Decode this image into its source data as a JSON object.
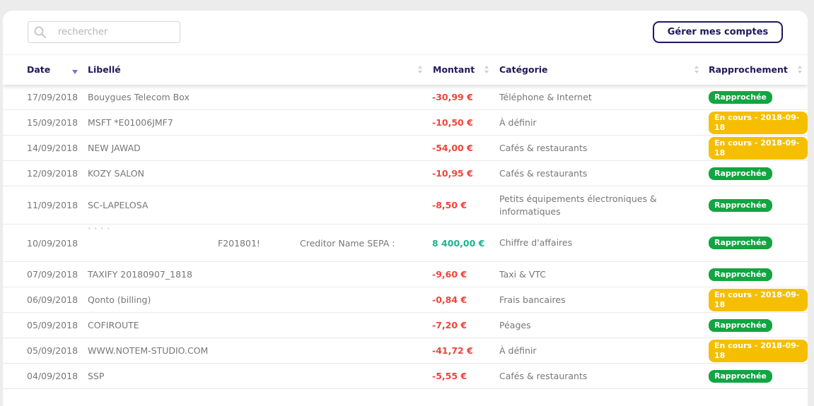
{
  "search": {
    "placeholder": "rechercher"
  },
  "manage_button": "Gérer mes comptes",
  "columns": {
    "date": "Date",
    "libelle": "Libellé",
    "montant": "Montant",
    "categorie": "Catégorie",
    "rapprochement": "Rapprochement"
  },
  "rows": [
    {
      "date": "17/09/2018",
      "libelle": "Bouygues Telecom Box",
      "montant": "-30,99 €",
      "categorie": "Téléphone & Internet",
      "status": "Rapprochée"
    },
    {
      "date": "15/09/2018",
      "libelle": "MSFT *E01006JMF7",
      "montant": "-10,50 €",
      "categorie": "À définir",
      "status": "En cours - 2018-09-18"
    },
    {
      "date": "14/09/2018",
      "libelle": "NEW JAWAD",
      "montant": "-54,00 €",
      "categorie": "Cafés & restaurants",
      "status": "En cours - 2018-09-18"
    },
    {
      "date": "12/09/2018",
      "libelle": "KOZY SALON",
      "montant": "-10,95 €",
      "categorie": "Cafés & restaurants",
      "status": "Rapprochée"
    },
    {
      "date": "11/09/2018",
      "libelle": "SC-LAPELOSA",
      "montant": "-8,50 €",
      "categorie": "Petits équipements électroniques & informatiques",
      "status": "Rapprochée"
    },
    {
      "date": "10/09/2018",
      "libelle_ticks": "` ` ` `",
      "libelle_ref": "F201801!",
      "libelle_creditor": "Creditor Name SEPA :",
      "montant": "8 400,00 €",
      "categorie": "Chiffre d'affaires",
      "status": "Rapprochée"
    },
    {
      "date": "07/09/2018",
      "libelle": "TAXIFY 20180907_1818",
      "montant": "-9,60 €",
      "categorie": "Taxi & VTC",
      "status": "Rapprochée"
    },
    {
      "date": "06/09/2018",
      "libelle": "Qonto (billing)",
      "montant": "-0,84 €",
      "categorie": "Frais bancaires",
      "status": "En cours - 2018-09-18"
    },
    {
      "date": "05/09/2018",
      "libelle": "COFIROUTE",
      "montant": "-7,20 €",
      "categorie": "Péages",
      "status": "Rapprochée"
    },
    {
      "date": "05/09/2018",
      "libelle": "WWW.NOTEM-STUDIO.COM",
      "montant": "-41,72 €",
      "categorie": "À définir",
      "status": "En cours - 2018-09-18"
    },
    {
      "date": "04/09/2018",
      "libelle": "SSP",
      "montant": "-5,55 €",
      "categorie": "Cafés & restaurants",
      "status": "Rapprochée"
    }
  ],
  "colors": {
    "accent": "#1f1a5a",
    "negative": "#f0433a",
    "positive": "#1cb28e",
    "reconciled": "#12a542",
    "pending": "#f5bf00",
    "sort_active": "#7d72d6"
  },
  "icons": {
    "search": "search-icon",
    "sort": "sort-icon",
    "sort_desc": "sort-desc-icon"
  }
}
